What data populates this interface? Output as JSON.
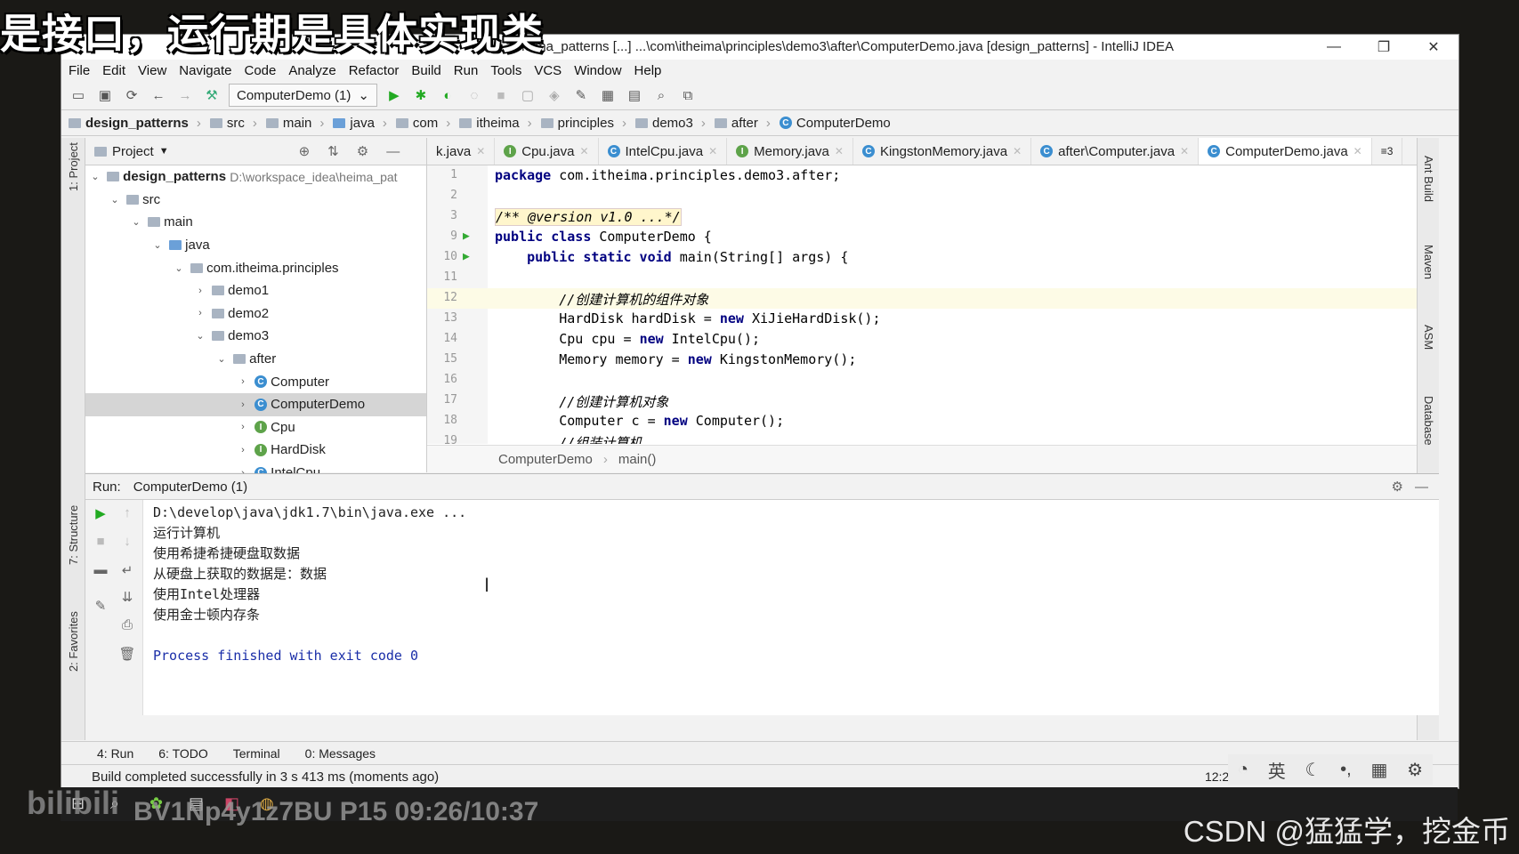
{
  "caption": "是接口，运行期是具体实现类",
  "window": {
    "title": "heima_patterns [...] ...\\com\\itheima\\principles\\demo3\\after\\ComputerDemo.java [design_patterns] - IntelliJ IDEA",
    "minimize": "—",
    "restore": "❐",
    "close": "✕"
  },
  "menu": [
    "File",
    "Edit",
    "View",
    "Navigate",
    "Code",
    "Analyze",
    "Refactor",
    "Build",
    "Run",
    "Tools",
    "VCS",
    "Window",
    "Help"
  ],
  "toolbar": {
    "run_config": "ComputerDemo (1)"
  },
  "breadcrumbs": [
    "design_patterns",
    "src",
    "main",
    "java",
    "com",
    "itheima",
    "principles",
    "demo3",
    "after",
    "ComputerDemo"
  ],
  "project": {
    "header": "Project",
    "root_name": "design_patterns",
    "root_path": "D:\\workspace_idea\\heima_pat",
    "nodes": [
      "src",
      "main",
      "java",
      "com.itheima.principles",
      "demo1",
      "demo2",
      "demo3",
      "after",
      "Computer",
      "ComputerDemo",
      "Cpu",
      "HardDisk",
      "IntelCpu"
    ]
  },
  "tabs": [
    "k.java",
    "Cpu.java",
    "IntelCpu.java",
    "Memory.java",
    "KingstonMemory.java",
    "after\\Computer.java",
    "ComputerDemo.java"
  ],
  "tabs_more": "≡3",
  "editor_lines": [
    {
      "n": "1",
      "text": "package com.itheima.principles.demo3.after;"
    },
    {
      "n": "2",
      "text": ""
    },
    {
      "n": "3",
      "text": "/** @version v1.0 ...*/"
    },
    {
      "n": "9",
      "text": "public class ComputerDemo {"
    },
    {
      "n": "10",
      "text": "    public static void main(String[] args) {"
    },
    {
      "n": "11",
      "text": ""
    },
    {
      "n": "12",
      "text": "        //创建计算机的组件对象"
    },
    {
      "n": "13",
      "text": "        HardDisk hardDisk = new XiJieHardDisk();"
    },
    {
      "n": "14",
      "text": "        Cpu cpu = new IntelCpu();"
    },
    {
      "n": "15",
      "text": "        Memory memory = new KingstonMemory();"
    },
    {
      "n": "16",
      "text": ""
    },
    {
      "n": "17",
      "text": "        //创建计算机对象"
    },
    {
      "n": "18",
      "text": "        Computer c = new Computer();"
    },
    {
      "n": "19",
      "text": "        //组装计算机"
    }
  ],
  "editor_crumbs": [
    "ComputerDemo",
    "main()"
  ],
  "run": {
    "label": "Run:",
    "config": "ComputerDemo (1)",
    "output": [
      "D:\\develop\\java\\jdk1.7\\bin\\java.exe ...",
      "运行计算机",
      "使用希捷希捷硬盘取数据",
      "从硬盘上获取的数据是：数据",
      "使用Intel处理器",
      "使用金士顿内存条"
    ],
    "exit": "Process finished with exit code 0"
  },
  "bottom_tabs": [
    "4: Run",
    "6: TODO",
    "Terminal",
    "0: Messages"
  ],
  "status": {
    "text": "Build completed successfully in 3 s 413 ms (moments ago)",
    "position": "12:21"
  },
  "side_tools": {
    "left": [
      "1: Project",
      "7: Structure",
      "2: Favorites"
    ],
    "right": [
      "Ant Build",
      "Maven",
      "ASM",
      "Database"
    ]
  },
  "watermarks": {
    "bilibili": "bilibili",
    "video": "BV1Np4y1z7BU P15 09:26/10:37",
    "csdn": "CSDN @猛猛学，挖金币"
  }
}
